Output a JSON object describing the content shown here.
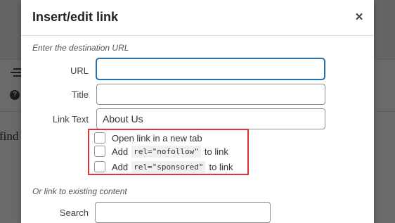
{
  "background": {
    "partial_text": "find"
  },
  "modal": {
    "title": "Insert/edit link",
    "close_glyph": "×",
    "url_section_title": "Enter the destination URL",
    "fields": {
      "url": {
        "label": "URL",
        "value": ""
      },
      "title": {
        "label": "Title",
        "value": ""
      },
      "link_text": {
        "label": "Link Text",
        "value": "About Us"
      }
    },
    "options": {
      "new_tab": {
        "label": "Open link in a new tab",
        "checked": false
      },
      "nofollow": {
        "prefix": "Add",
        "code": "rel=\"nofollow\"",
        "suffix": "to link",
        "checked": false
      },
      "sponsored": {
        "prefix": "Add",
        "code": "rel=\"sponsored\"",
        "suffix": "to link",
        "checked": false
      }
    },
    "existing_section_title": "Or link to existing content",
    "search": {
      "label": "Search",
      "value": ""
    }
  },
  "colors": {
    "accent": "#2271b1",
    "highlight": "#e0303a"
  },
  "icons": [
    "menu-bars-icon",
    "help-icon",
    "close-icon"
  ]
}
